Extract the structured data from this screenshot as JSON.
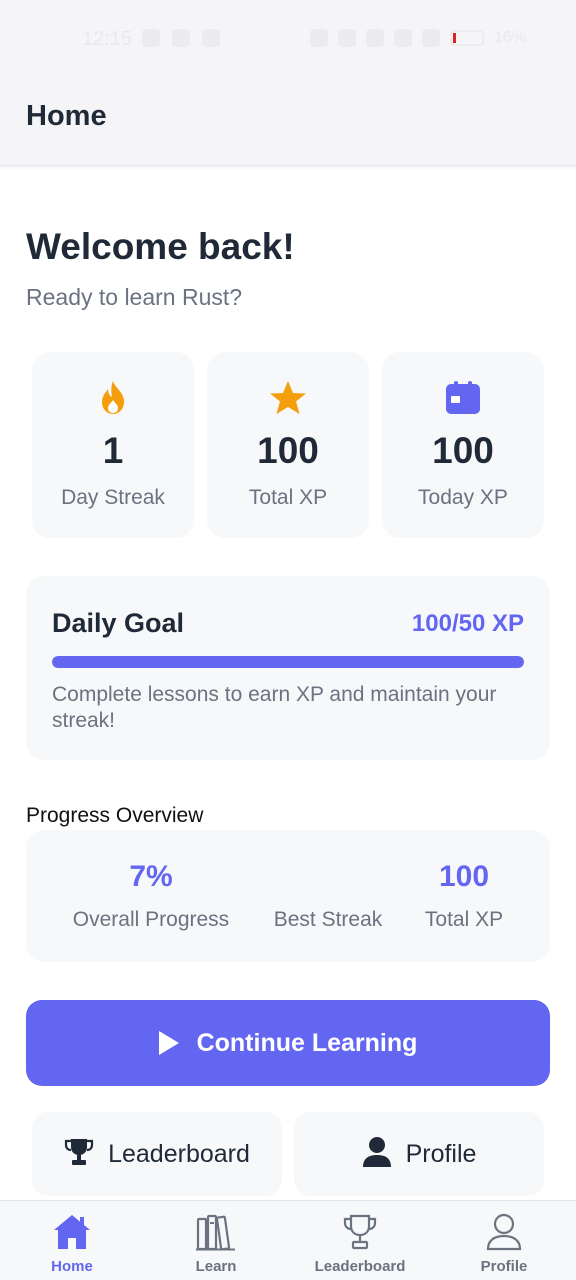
{
  "status_bar": {
    "time": "12:15",
    "battery": "16%"
  },
  "app_bar": {
    "title": "Home"
  },
  "welcome": {
    "title": "Welcome back!",
    "subtitle": "Ready to learn Rust?"
  },
  "stats": [
    {
      "icon": "flame-icon",
      "value": "1",
      "label": "Day Streak",
      "color": "#f59e0b"
    },
    {
      "icon": "star-icon",
      "value": "100",
      "label": "Total XP",
      "color": "#f59e0b"
    },
    {
      "icon": "calendar-icon",
      "value": "100",
      "label": "Today XP",
      "color": "#6366f1"
    }
  ],
  "daily_goal": {
    "title": "Daily Goal",
    "xp_text": "100/50 XP",
    "progress_fraction": 1.0,
    "description": "Complete lessons to earn XP and maintain your streak!"
  },
  "progress_overview": {
    "title": "Progress Overview",
    "items": [
      {
        "value": "7%",
        "label": "Overall Progress"
      },
      {
        "value": "",
        "label": "Best Streak"
      },
      {
        "value": "100",
        "label": "Total XP"
      }
    ]
  },
  "continue_button": {
    "label": "Continue Learning",
    "icon": "play-icon"
  },
  "quick_links": [
    {
      "label": "Leaderboard",
      "icon": "trophy-icon"
    },
    {
      "label": "Profile",
      "icon": "user-icon"
    }
  ],
  "tab_bar": {
    "active": "Home",
    "tabs": [
      {
        "label": "Home",
        "icon": "home-icon"
      },
      {
        "label": "Learn",
        "icon": "books-icon"
      },
      {
        "label": "Leaderboard",
        "icon": "trophy-icon"
      },
      {
        "label": "Profile",
        "icon": "user-icon"
      }
    ]
  },
  "colors": {
    "accent": "#6366f1",
    "warm": "#f59e0b",
    "text": "#1f2937",
    "muted": "#6b7280"
  }
}
